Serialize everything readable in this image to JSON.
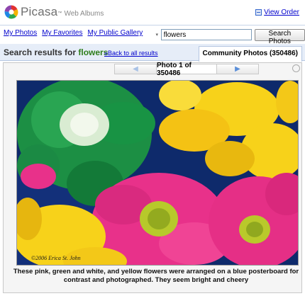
{
  "header": {
    "brand": "Picasa",
    "brand_tm": "™",
    "brand_sub": "Web Albums",
    "view_order": "View Order"
  },
  "nav": {
    "links": [
      "My Photos",
      "My Favorites",
      "My Public Gallery"
    ]
  },
  "search": {
    "value": "flowers",
    "button": "Search Photos"
  },
  "results": {
    "prefix": "Search results for",
    "query": "flowers",
    "back": "«Back to all results",
    "tab": "Community Photos (350486)"
  },
  "viewer": {
    "prev": "◀",
    "next": "▶",
    "counter": "Photo 1 of 350486",
    "watermark": "©2006 Erica St. John",
    "caption": "These pink, green and white, and yellow flowers were arranged on a blue posterboard for contrast and photographed. They seem bright and cheery"
  },
  "colors": {
    "link": "#0000cc",
    "query_green": "#2e7d1a",
    "results_bg": "#e6edf8",
    "posterboard_blue": "#0e2a6b",
    "flower_pink": "#e8318a",
    "flower_yellow": "#f7d21a",
    "flower_green": "#1f9a4a"
  }
}
